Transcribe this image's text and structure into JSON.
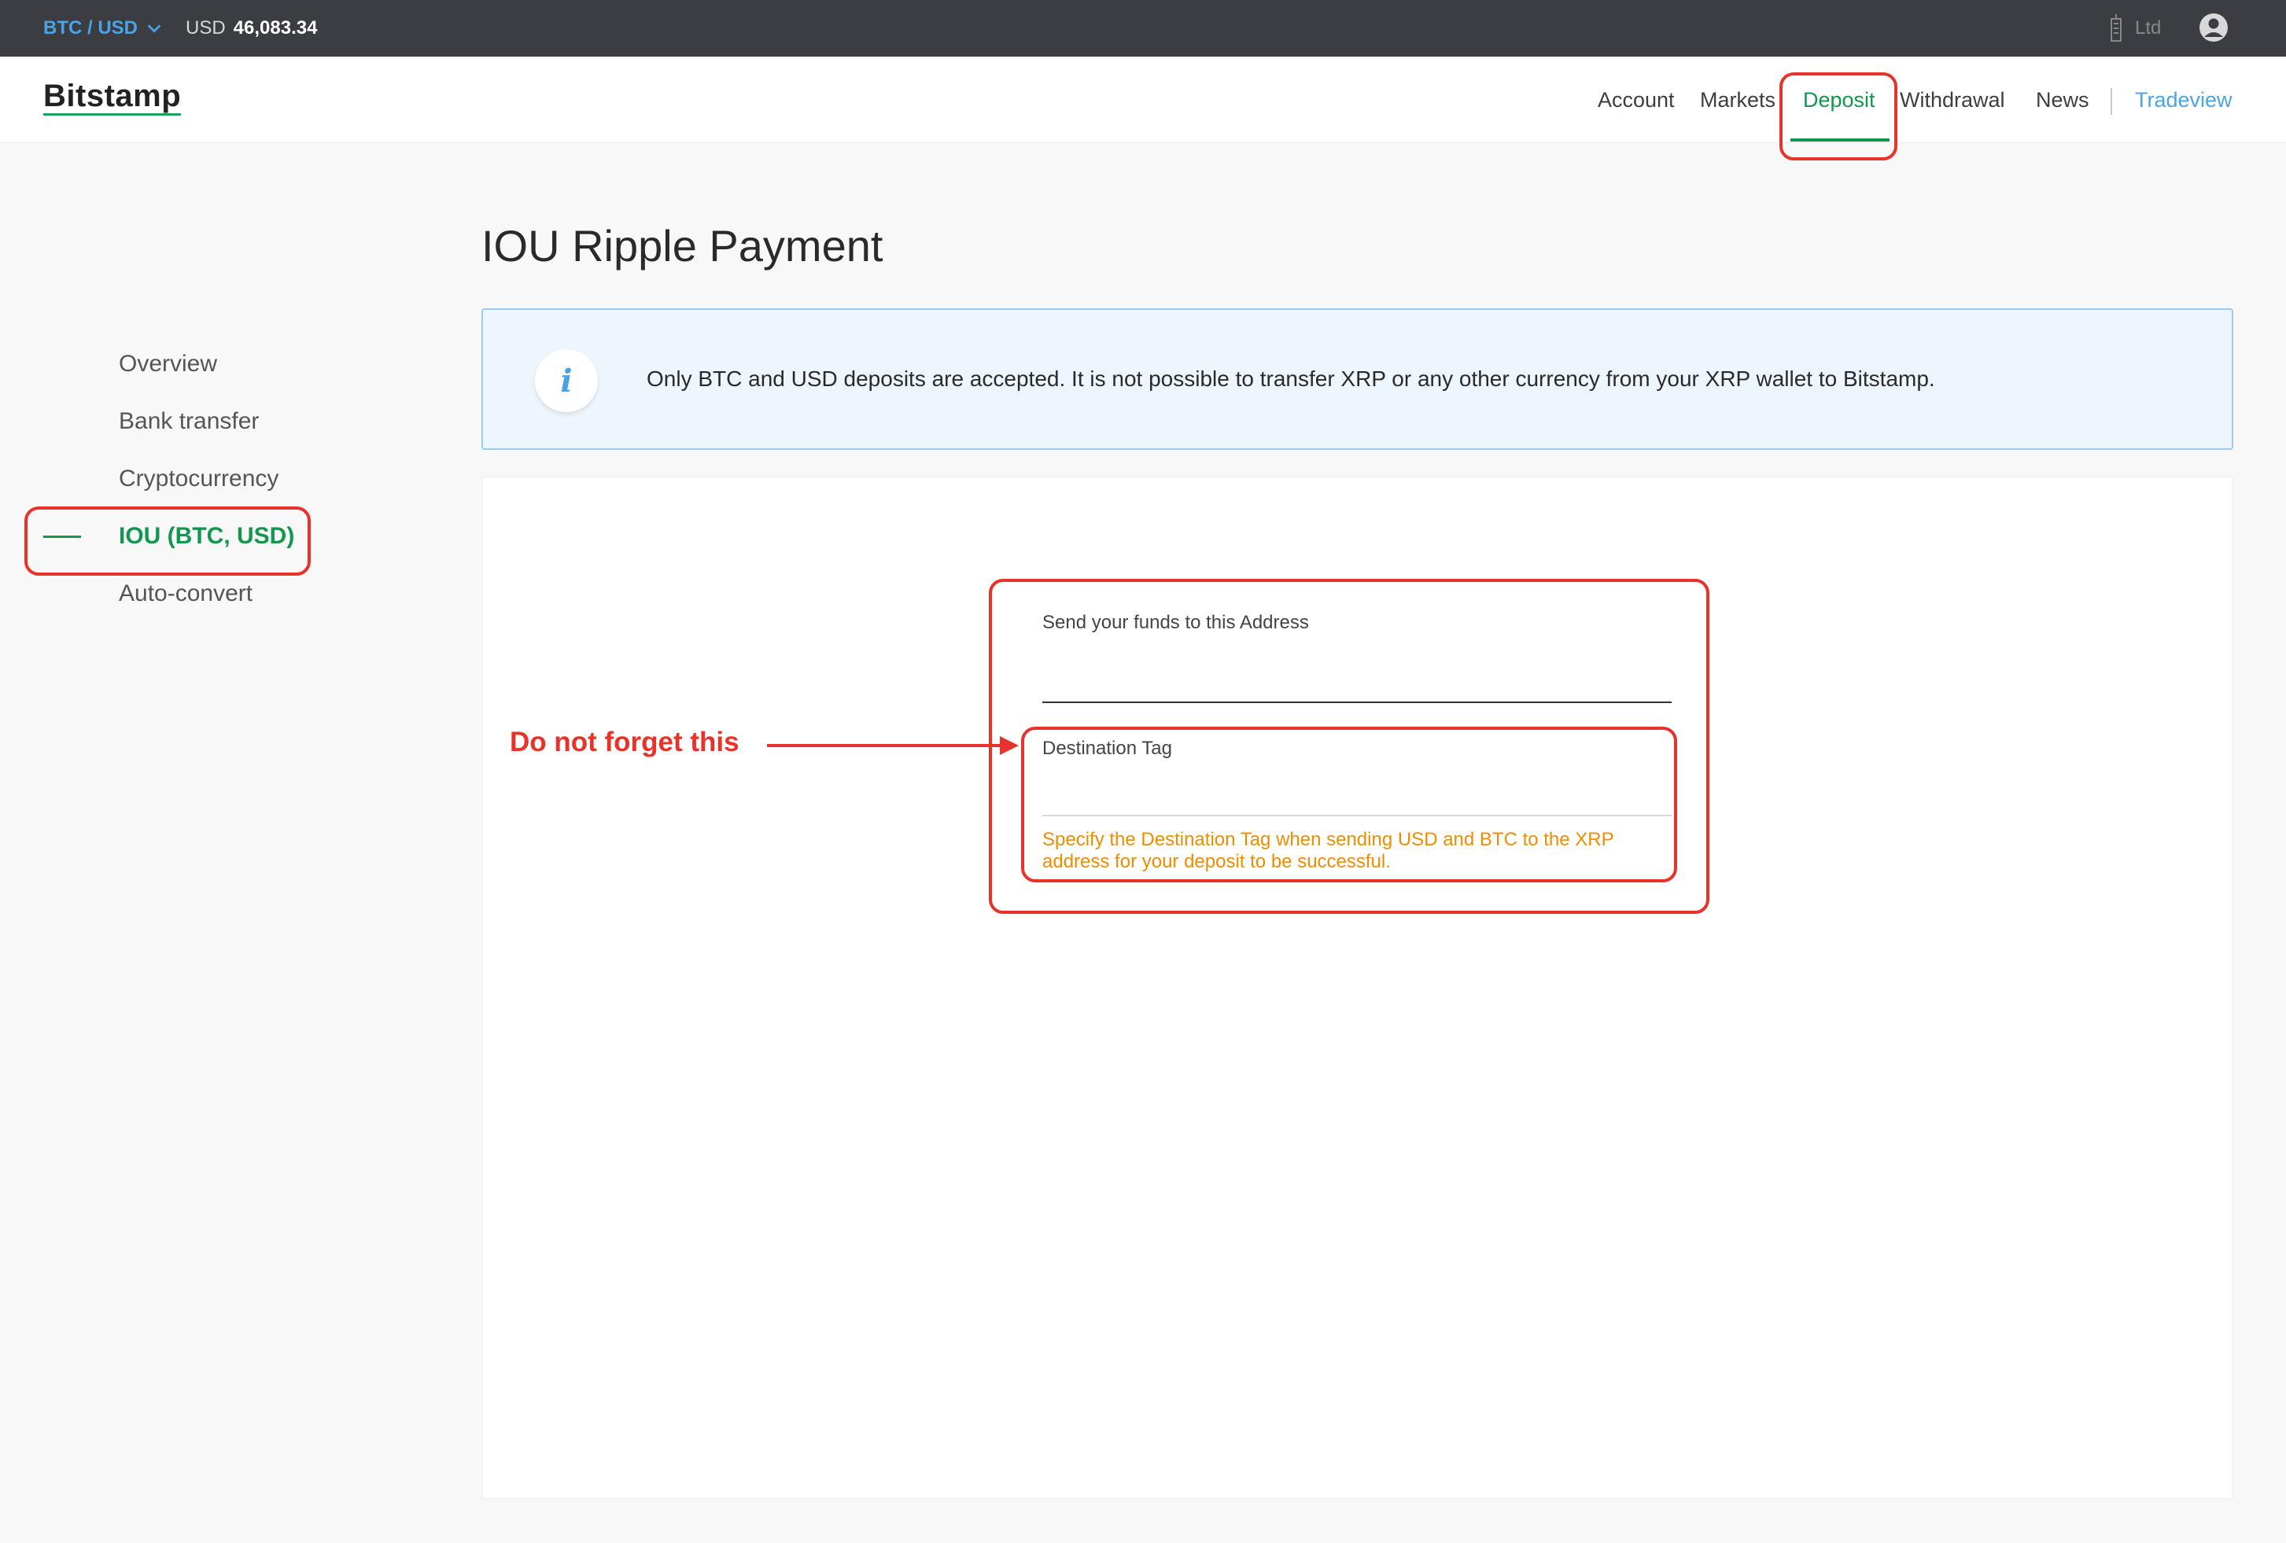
{
  "topbar": {
    "pair": "BTC / USD",
    "price_currency": "USD",
    "price_value": "46,083.34",
    "account_name": "Ltd",
    "icons": [
      "chevron-down-icon",
      "building-icon",
      "user-circle-icon"
    ]
  },
  "header": {
    "logo": "Bitstamp",
    "nav": {
      "account": "Account",
      "markets": "Markets",
      "deposit": "Deposit",
      "withdrawal": "Withdrawal",
      "news": "News",
      "tradeview": "Tradeview"
    },
    "active_item": "Deposit"
  },
  "sidebar": {
    "items": [
      {
        "label": "Overview"
      },
      {
        "label": "Bank transfer"
      },
      {
        "label": "Cryptocurrency"
      },
      {
        "label": "IOU (BTC, USD)"
      },
      {
        "label": "Auto-convert"
      }
    ],
    "active_index": 3
  },
  "main": {
    "title": "IOU Ripple Payment",
    "info_text": "Only BTC and USD deposits are accepted. It is not possible to transfer XRP or any other currency from your XRP wallet to Bitstamp.",
    "address_label": "Send your funds to this Address",
    "address_value": "",
    "tag_label": "Destination Tag",
    "tag_value": "",
    "tag_hint_line1": "Specify the Destination Tag when sending USD and BTC to the XRP",
    "tag_hint_line2": "address for your deposit to be successful."
  },
  "annotation": {
    "text": "Do not forget this",
    "color": "#e8332a"
  },
  "colors": {
    "accent_green": "#13974f",
    "link_blue": "#4aa3e6",
    "warning_orange": "#f08c00",
    "topbar_bg": "#3b3d42"
  }
}
